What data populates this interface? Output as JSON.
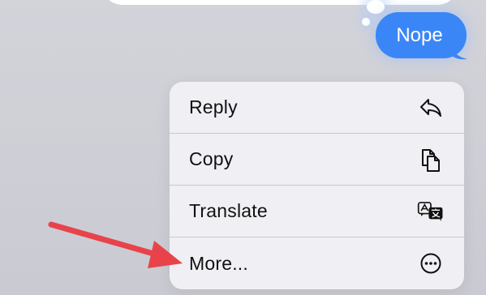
{
  "conversation": {
    "outgoing_message": "Nope"
  },
  "context_menu": {
    "items": [
      {
        "label": "Reply",
        "icon": "reply-arrow-icon"
      },
      {
        "label": "Copy",
        "icon": "copy-docs-icon"
      },
      {
        "label": "Translate",
        "icon": "translate-icon"
      },
      {
        "label": "More...",
        "icon": "ellipsis-circle-icon"
      }
    ]
  },
  "colors": {
    "bubble_blue": "#3b86f7",
    "menu_background": "#f0f0f4",
    "annotation_arrow": "#e8434a"
  }
}
